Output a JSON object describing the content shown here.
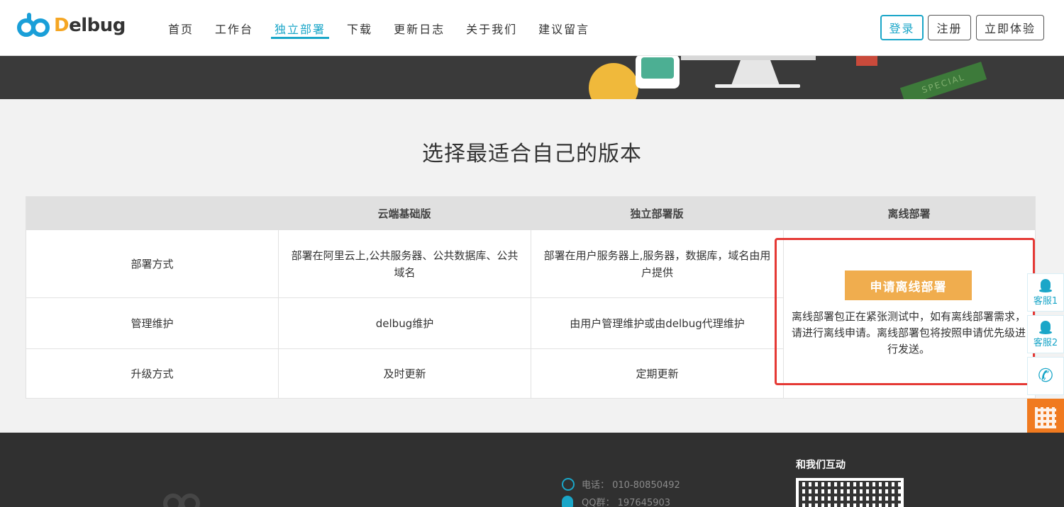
{
  "brand": {
    "logo_d": "D",
    "logo_rest": "elbug"
  },
  "nav": {
    "items": [
      {
        "label": "首页"
      },
      {
        "label": "工作台"
      },
      {
        "label": "独立部署"
      },
      {
        "label": "下载"
      },
      {
        "label": "更新日志"
      },
      {
        "label": "关于我们"
      },
      {
        "label": "建议留言"
      }
    ],
    "active_index": 2
  },
  "header_buttons": {
    "login": "登录",
    "register": "注册",
    "trial": "立即体验"
  },
  "banner": {
    "ribbon_text": "SPECIAL"
  },
  "section": {
    "title": "选择最适合自己的版本"
  },
  "table": {
    "columns": [
      "",
      "云端基础版",
      "独立部署版",
      "离线部署"
    ],
    "rows": [
      {
        "label": "部署方式",
        "cloud": "部署在阿里云上,公共服务器、公共数据库、公共域名",
        "standalone": "部署在用户服务器上,服务器，数据库，域名由用户提供"
      },
      {
        "label": "管理维护",
        "cloud": "delbug维护",
        "standalone": "由用户管理维护或由delbug代理维护"
      },
      {
        "label": "升级方式",
        "cloud": "及时更新",
        "standalone": "定期更新"
      }
    ],
    "offline": {
      "button_label": "申请离线部署",
      "note": "离线部署包正在紧张测试中，如有离线部署需求，请进行离线申请。离线部署包将按照申请优先级进行发送。"
    }
  },
  "float_bar": {
    "service1": "客服1",
    "service2": "客服2"
  },
  "footer": {
    "phone": "电话：  010-80850492",
    "qq": "QQ群：  197645903",
    "interact_title": "和我们互动"
  },
  "colors": {
    "accent": "#1aa6c8",
    "offline_button": "#f0ad4e",
    "highlight_border": "#e53935"
  }
}
